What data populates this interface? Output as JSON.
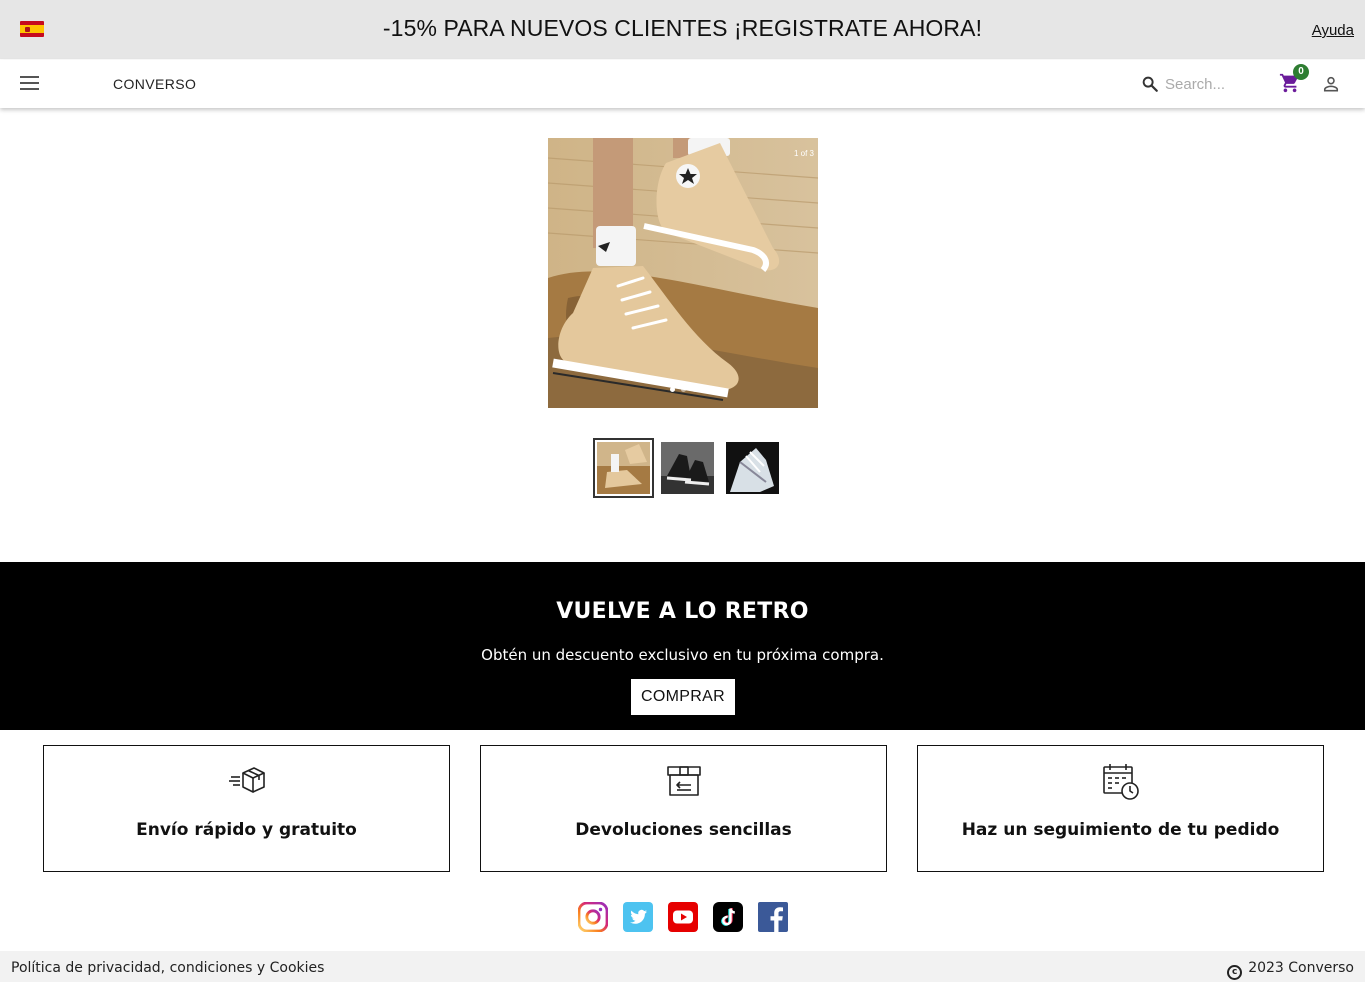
{
  "topbar": {
    "flag_icon": "spain-flag-icon",
    "promo": "-15% PARA NUEVOS CLIENTES ¡REGISTRATE AHORA!",
    "help": "Ayuda"
  },
  "navbar": {
    "brand": "CONVERSO",
    "search_placeholder": "Search...",
    "cart_count": "0",
    "cart_color": "#6a1b9a",
    "badge_color": "#2e7d32"
  },
  "hero": {
    "counter": "1 of 3",
    "slide_count": 3,
    "active_slide": 1
  },
  "banner": {
    "title": "VUELVE A LO RETRO",
    "subtitle": "Obtén un descuento exclusivo en tu próxima compra.",
    "button": "COMPRAR"
  },
  "features": [
    {
      "icon": "shipping-box-icon",
      "title": "Envío rápido y gratuito"
    },
    {
      "icon": "returns-box-icon",
      "title": "Devoluciones sencillas"
    },
    {
      "icon": "calendar-clock-icon",
      "title": "Haz un seguimiento de tu pedido"
    }
  ],
  "social": [
    "instagram-icon",
    "twitter-icon",
    "youtube-icon",
    "tiktok-icon",
    "facebook-icon"
  ],
  "footer": {
    "policy": "Política de privacidad, condiciones y Cookies",
    "copyright": "2023 Converso"
  }
}
